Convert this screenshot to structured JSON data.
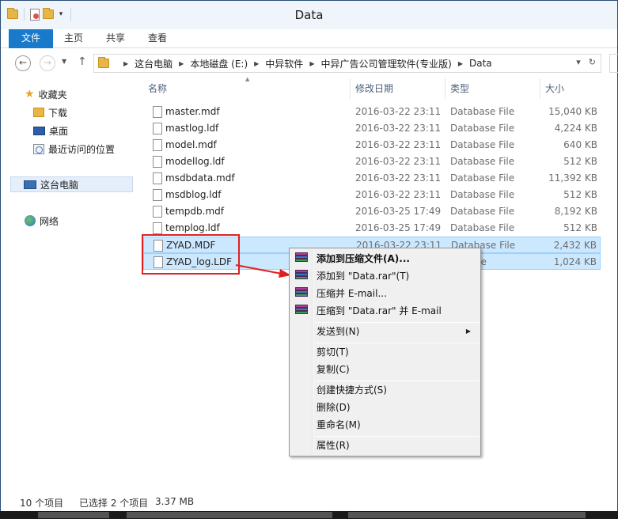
{
  "window": {
    "title": "Data"
  },
  "ribbon": {
    "tabs": [
      "文件",
      "主页",
      "共享",
      "查看"
    ]
  },
  "address": {
    "crumbs": [
      "这台电脑",
      "本地磁盘 (E:)",
      "中异软件",
      "中异广告公司管理软件(专业版)",
      "Data"
    ]
  },
  "nav_pane": {
    "favorites": "收藏夹",
    "downloads": "下载",
    "desktop": "桌面",
    "recent": "最近访问的位置",
    "this_pc": "这台电脑",
    "network": "网络"
  },
  "columns": {
    "name": "名称",
    "date": "修改日期",
    "type": "类型",
    "size": "大小"
  },
  "files": [
    {
      "name": "master.mdf",
      "date": "2016-03-22 23:11",
      "type": "Database File",
      "size": "15,040 KB"
    },
    {
      "name": "mastlog.ldf",
      "date": "2016-03-22 23:11",
      "type": "Database File",
      "size": "4,224 KB"
    },
    {
      "name": "model.mdf",
      "date": "2016-03-22 23:11",
      "type": "Database File",
      "size": "640 KB"
    },
    {
      "name": "modellog.ldf",
      "date": "2016-03-22 23:11",
      "type": "Database File",
      "size": "512 KB"
    },
    {
      "name": "msdbdata.mdf",
      "date": "2016-03-22 23:11",
      "type": "Database File",
      "size": "11,392 KB"
    },
    {
      "name": "msdblog.ldf",
      "date": "2016-03-22 23:11",
      "type": "Database File",
      "size": "512 KB"
    },
    {
      "name": "tempdb.mdf",
      "date": "2016-03-25 17:49",
      "type": "Database File",
      "size": "8,192 KB"
    },
    {
      "name": "templog.ldf",
      "date": "2016-03-25 17:49",
      "type": "Database File",
      "size": "512 KB"
    },
    {
      "name": "ZYAD.MDF",
      "date": "2016-03-22 23:11",
      "type": "Database File",
      "size": "2,432 KB",
      "selected": true
    },
    {
      "name": "ZYAD_log.LDF",
      "date": "",
      "type": "ase File",
      "size": "1,024 KB",
      "selected": true
    }
  ],
  "context_menu": {
    "add_archive": "添加到压缩文件(A)...",
    "add_to_rar": "添加到 \"Data.rar\"(T)",
    "compress_email": "压缩并 E-mail...",
    "compress_rar_email": "压缩到 \"Data.rar\" 并 E-mail",
    "send_to": "发送到(N)",
    "cut": "剪切(T)",
    "copy": "复制(C)",
    "create_shortcut": "创建快捷方式(S)",
    "delete": "删除(D)",
    "rename": "重命名(M)",
    "properties": "属性(R)"
  },
  "status": {
    "item_count": "10 个项目",
    "selection": "已选择 2 个项目",
    "selection_size": "3.37 MB"
  },
  "colors": {
    "accent": "#1979ca",
    "selection": "#cce8ff",
    "annotation": "#e02020"
  }
}
